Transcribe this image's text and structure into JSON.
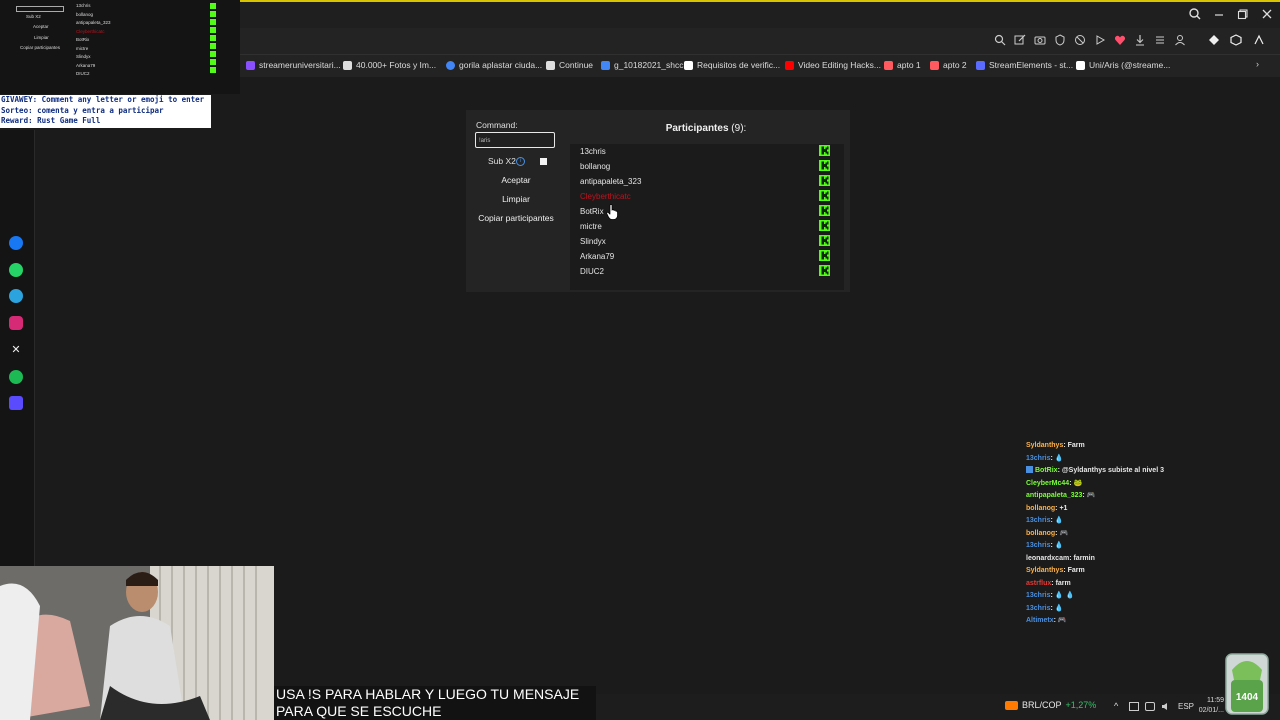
{
  "browser": {
    "bookmarks": [
      {
        "label": "streameruniversitari...",
        "color": "#8a4fff"
      },
      {
        "label": "40.000+ Fotos y Im...",
        "color": "#dddddd"
      },
      {
        "label": "gorila aplastar ciuda...",
        "color": "#4285f4"
      },
      {
        "label": "Continue",
        "color": "#dddddd"
      },
      {
        "label": "g_10182021_shcc",
        "color": "#4285f4"
      },
      {
        "label": "Requisitos de verific...",
        "color": "#ffffff"
      },
      {
        "label": "Video Editing Hacks...",
        "color": "#ff0000"
      },
      {
        "label": "apto 1",
        "color": "#ff5a5f"
      },
      {
        "label": "apto 2",
        "color": "#ff5a5f"
      },
      {
        "label": "StreamElements - st...",
        "color": "#5b6bff"
      },
      {
        "label": "Uni/Aris (@streame...",
        "color": "#ffffff"
      }
    ]
  },
  "mini_preview": {
    "left_items": [
      "Sub X2",
      "Aceptar",
      "Limpiar",
      "Copiar participantes"
    ],
    "list": [
      "13chris",
      "bollanog",
      "antipapaleta_323",
      "Cleyberthicatc",
      "BotRix",
      "mictre",
      "Slindyx",
      "Arkana79",
      "DIUC2"
    ]
  },
  "giveaway": {
    "line1": "GIVAWEY: Comment any letter or emoji to enter",
    "line2": "Sorteo: comenta y entra a participar",
    "line3": "Reward: Rust Game Full"
  },
  "panel": {
    "command_label": "Command:",
    "command_value": "!aris",
    "sub_label": "Sub X2",
    "sub_info": "i",
    "buttons": {
      "accept": "Aceptar",
      "clear": "Limpiar",
      "copy": "Copiar participantes"
    },
    "participants_title": "Participantes",
    "participants_count": "(9):",
    "participants": [
      {
        "name": "13chris",
        "removed": false
      },
      {
        "name": "bollanog",
        "removed": false
      },
      {
        "name": "antipapaleta_323",
        "removed": false
      },
      {
        "name": "Cleyberthicatc",
        "removed": true
      },
      {
        "name": "BotRix",
        "removed": false
      },
      {
        "name": "mictre",
        "removed": false
      },
      {
        "name": "Slindyx",
        "removed": false
      },
      {
        "name": "Arkana79",
        "removed": false
      },
      {
        "name": "DIUC2",
        "removed": false
      }
    ],
    "kick_color": "#53fc18"
  },
  "chat": [
    {
      "user": "Syldanthys",
      "color": "#ffb347",
      "msg": ": Farm"
    },
    {
      "user": "13chris",
      "color": "#4a90e2",
      "msg": ": 💧"
    },
    {
      "user": "BotRix",
      "color": "#7cff3a",
      "msg": ": @Syldanthys subiste al nivel 3"
    },
    {
      "user": "CleyberMc44",
      "color": "#7cff3a",
      "msg": ": 🐸"
    },
    {
      "user": "antipapaleta_323",
      "color": "#7cff3a",
      "msg": ": 🎮"
    },
    {
      "user": "bollanog",
      "color": "#ffb347",
      "msg": ": +1"
    },
    {
      "user": "13chris",
      "color": "#4a90e2",
      "msg": ": 💧"
    },
    {
      "user": "bollanog",
      "color": "#ffb347",
      "msg": ": 🎮"
    },
    {
      "user": "13chris",
      "color": "#4a90e2",
      "msg": ": 💧"
    },
    {
      "user": "leonardxcam",
      "color": "#e8e8e8",
      "msg": ": farmin"
    },
    {
      "user": "Syldanthys",
      "color": "#ffb347",
      "msg": ": Farm"
    },
    {
      "user": "astrflux",
      "color": "#e53935",
      "msg": ": farm"
    },
    {
      "user": "13chris",
      "color": "#4a90e2",
      "msg": ": 💧 💧"
    },
    {
      "user": "13chris",
      "color": "#4a90e2",
      "msg": ": 💧"
    },
    {
      "user": "Altimetx",
      "color": "#4a90e2",
      "msg": ": 🎮"
    }
  ],
  "caption": {
    "line1": "USA !S PARA HABLAR Y LUEGO TU MENSAJE",
    "line2": "PARA QUE SE ESCUCHE"
  },
  "taskbar": {
    "ticker_label": "BRL/COP",
    "ticker_change": "+1,27%",
    "lang": "ESP",
    "time": "11:59",
    "date": "02/01/..."
  },
  "plant_label": "1404"
}
